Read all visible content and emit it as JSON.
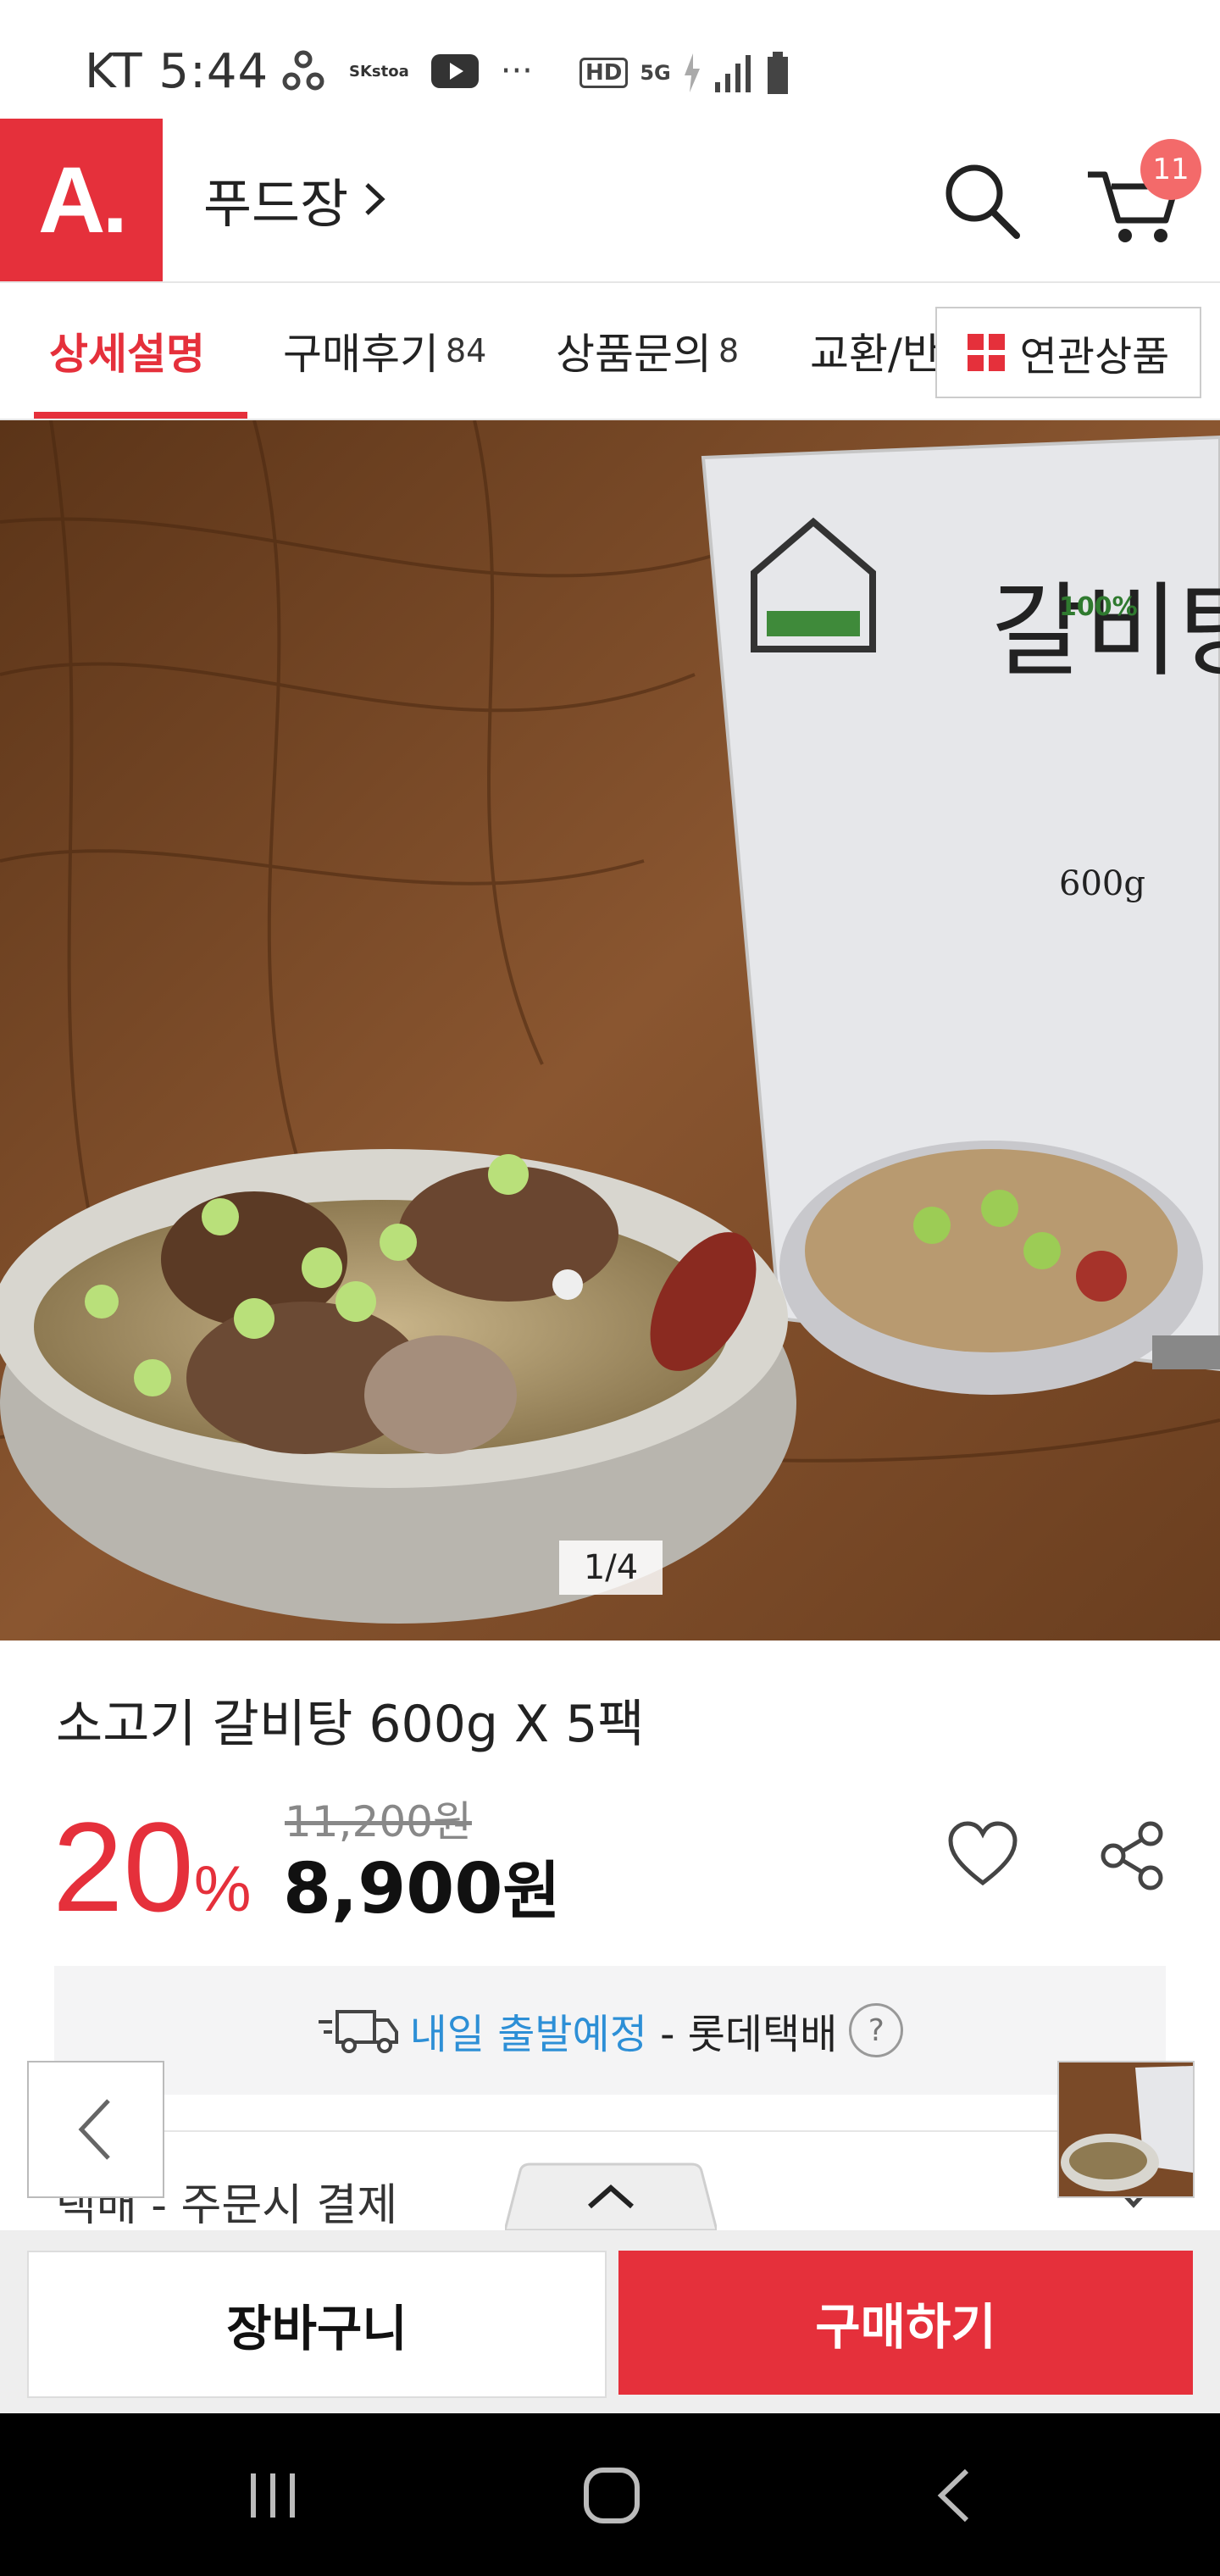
{
  "status_bar": {
    "carrier_time": "KT 5:44",
    "skstoa": "SKstoa",
    "dots": "···",
    "hd": "HD",
    "net": "5G"
  },
  "header": {
    "logo_text": "A.",
    "category": "푸드장",
    "cart_count": "11"
  },
  "tabs": {
    "items": [
      {
        "label": "상세설명",
        "count": ""
      },
      {
        "label": "구매후기",
        "count": "84"
      },
      {
        "label": "상품문의",
        "count": "8"
      },
      {
        "label": "교환/반",
        "count": ""
      }
    ],
    "related_label": "연관상품"
  },
  "hero": {
    "counter": "1/4",
    "pack_name": "갈비탕",
    "pack_weight": "600g",
    "pack_claim": "100%"
  },
  "product": {
    "title": "소고기 갈비탕 600g X 5팩",
    "discount_num": "20",
    "discount_unit": "%",
    "original_price": "11,200원",
    "price_num": "8,900",
    "price_unit": "원"
  },
  "shipping": {
    "highlight": "내일 출발예정",
    "carrier": " - 롯데택배",
    "help": "?"
  },
  "payment_row": "택배 - 주문시 결제",
  "buttons": {
    "add_to_cart": "장바구니",
    "buy_now": "구매하기"
  },
  "colors": {
    "brand_red": "#e5303b",
    "link_blue": "#2d8fd6",
    "badge": "#f36a6a"
  }
}
